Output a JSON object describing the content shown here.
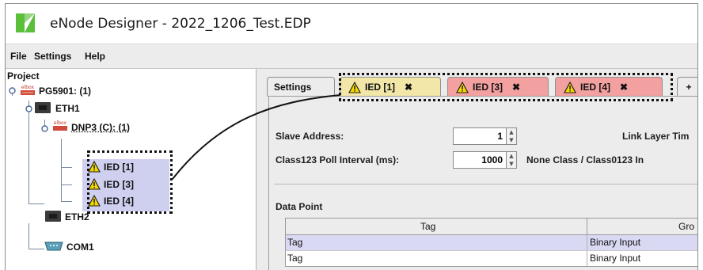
{
  "window": {
    "title": "eNode Designer - 2022_1206_Test.EDP",
    "logo_color": "#5bbf3a"
  },
  "menu": {
    "items": [
      "File",
      "Settings",
      "Help"
    ]
  },
  "tree": {
    "root": "Project",
    "device": "PG5901: (1)",
    "eth1": "ETH1",
    "protocol": "DNP3 (C): (1)",
    "ieds": [
      "IED [1]",
      "IED [3]",
      "IED [4]"
    ],
    "eth2": "ETH2",
    "com1": "COM1"
  },
  "tabs": [
    {
      "label": "Settings",
      "closable": false,
      "active": true
    },
    {
      "label": "IED [1]",
      "closable": true,
      "warning": true,
      "color": "#f2e7a8"
    },
    {
      "label": "IED [3]",
      "closable": true,
      "warning": true,
      "color": "#f2a0a0"
    },
    {
      "label": "IED [4]",
      "closable": true,
      "warning": true,
      "color": "#f2a0a0"
    },
    {
      "label": "+",
      "closable": false
    }
  ],
  "form": {
    "slave_address_label": "Slave Address:",
    "slave_address_value": "1",
    "link_layer_label": "Link Layer Tim",
    "class123_label": "Class123 Poll Interval (ms):",
    "class123_value": "1000",
    "none_class_label": "None Class / Class0123 In"
  },
  "data_point": {
    "section_label": "Data Point",
    "columns": [
      "Tag",
      "Gro"
    ],
    "rows": [
      [
        "Tag",
        "Binary Input"
      ],
      [
        "Tag",
        "Binary Input"
      ]
    ],
    "row_highlight": "#d9d9f3"
  },
  "colors": {
    "warning": "#f5d800",
    "annotation": "#111111"
  }
}
